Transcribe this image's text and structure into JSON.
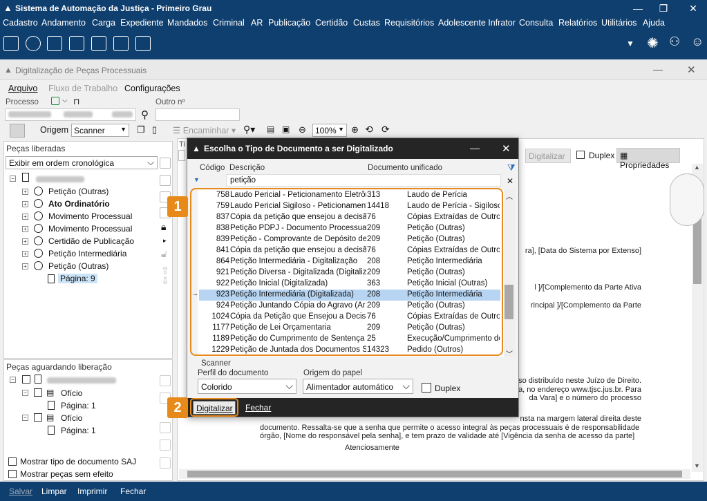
{
  "app": {
    "title": "Sistema de Automação da Justiça - Primeiro Grau",
    "menu": [
      "Cadastro",
      "Andamento",
      "Carga",
      "Expediente",
      "Mandados",
      "Criminal",
      "AR",
      "Publicação",
      "Certidão",
      "Custas",
      "Requisitórios",
      "Adolescente Infrator",
      "Consulta",
      "Relatórios",
      "Utilitários",
      "Ajuda"
    ]
  },
  "window": {
    "title": "Digitalização de Peças Processuais",
    "menu": {
      "arquivo": "Arquivo",
      "fluxo": "Fluxo de Trabalho",
      "config": "Configurações"
    },
    "processo_label": "Processo",
    "outro_label": "Outro nº",
    "origem_label": "Origem",
    "origem_value": "Scanner",
    "encaminhar": "Encaminhar",
    "zoom": "100%",
    "digitalizar_bg": "Digitalizar",
    "duplex_bg": "Duplex",
    "propriedades": "Propriedades"
  },
  "left": {
    "liberadas_title": "Peças liberadas",
    "sort": "Exibir em ordem cronológica",
    "tree": [
      {
        "label": "Petição (Outras)",
        "bold": false
      },
      {
        "label": "Ato Ordinatório",
        "bold": true
      },
      {
        "label": "Movimento Processual",
        "bold": false
      },
      {
        "label": "Movimento Processual",
        "bold": false
      },
      {
        "label": "Certidão de Publicação",
        "bold": false
      },
      {
        "label": "Petição Intermediária",
        "bold": false
      },
      {
        "label": "Petição (Outras)",
        "bold": false
      }
    ],
    "pagina_sel": "Página: 9",
    "aguardando_title": "Peças aguardando liberação",
    "aguardando": [
      {
        "label": "Ofício",
        "page": "Página: 1"
      },
      {
        "label": "Ofício",
        "page": "Página: 1"
      }
    ],
    "mostrar_tipo": "Mostrar tipo de documento SAJ",
    "mostrar_pecas": "Mostrar peças sem efeito"
  },
  "doc": {
    "lines": [
      "ra], [Data do Sistema por Extenso]",
      "l ]/[Complemento da Parte Ativa",
      "rincipal ]/[Complemento da Parte",
      "esso distribuído neste Juízo de Direito.",
      "a, no endereço www.tjsc.jus.br. Para",
      "da Vara] e o número do processo",
      "nsta na margem lateral direita deste",
      "documento. Ressalta-se que a senha que permite o acesso integral às peças processuais é de responsabilidade",
      "órgão, [Nome do responsável pela senha], e tem prazo de validade até [Vigência da senha de acesso da parte]",
      "Atenciosamente"
    ]
  },
  "bottom": [
    "Salvar",
    "Limpar",
    "Imprimir",
    "Fechar"
  ],
  "dialog": {
    "title": "Escolha o Tipo de Documento a ser Digitalizado",
    "col_codigo": "Código",
    "col_descricao": "Descrição",
    "col_unificado": "Documento unificado",
    "filter": "petição",
    "rows": [
      {
        "code": "758",
        "desc": "Laudo Pericial - Peticionamento Eletrôn",
        "ucode": "313",
        "udesc": "Laudo de Perícia"
      },
      {
        "code": "759",
        "desc": "Laudo Pericial Sigiloso - Peticionament",
        "ucode": "14418",
        "udesc": "Laudo de Perícia - Sigiloso"
      },
      {
        "code": "837",
        "desc": "Cópia da petição que ensejou a decisão",
        "ucode": "76",
        "udesc": "Cópias Extraídas de Outros"
      },
      {
        "code": "838",
        "desc": "Petição PDPJ - Documento Processual",
        "ucode": "209",
        "udesc": "Petição (Outras)"
      },
      {
        "code": "839",
        "desc": "Petição - Comprovante de Depósito de",
        "ucode": "209",
        "udesc": "Petição (Outras)"
      },
      {
        "code": "841",
        "desc": "Cópia da petição que ensejou a decisão",
        "ucode": "76",
        "udesc": "Cópias Extraídas de Outros"
      },
      {
        "code": "864",
        "desc": "Petição Intermediária - Digitalização",
        "ucode": "208",
        "udesc": "Petição Intermediária"
      },
      {
        "code": "921",
        "desc": "Petição Diversa - Digitalizada (Digitaliz",
        "ucode": "209",
        "udesc": "Petição (Outras)"
      },
      {
        "code": "922",
        "desc": "Petição Inicial (Digitalizada)",
        "ucode": "363",
        "udesc": "Petição Inicial (Outras)"
      },
      {
        "code": "923",
        "desc": "Petição Intermediária (Digitalizada)",
        "ucode": "208",
        "udesc": "Petição Intermediária"
      },
      {
        "code": "924",
        "desc": "Petição Juntando Cópia do Agravo (Ar",
        "ucode": "209",
        "udesc": "Petição (Outras)"
      },
      {
        "code": "1024",
        "desc": "Cópia da Petição que Ensejou a Decisão",
        "ucode": "76",
        "udesc": "Cópias Extraídas de Outros"
      },
      {
        "code": "1177",
        "desc": "Petição de Lei Orçamentaria",
        "ucode": "209",
        "udesc": "Petição (Outras)"
      },
      {
        "code": "1189",
        "desc": "Petição do Cumprimento de Sentença",
        "ucode": "25",
        "udesc": "Execução/Cumprimento de"
      },
      {
        "code": "1229",
        "desc": "Petição de Juntada dos Documentos Sc",
        "ucode": "14323",
        "udesc": "Pedido (Outros)"
      }
    ],
    "selected_index": 9,
    "scanner_label": "Scanner",
    "perfil_label": "Perfil do documento",
    "perfil_value": "Colorido",
    "origem_papel_label": "Origem do papel",
    "origem_papel_value": "Alimentador automático",
    "duplex": "Duplex",
    "btn_digitalizar": "Digitalizar",
    "btn_fechar": "Fechar",
    "badge1": "1",
    "badge2": "2"
  },
  "colors": {
    "navy": "#0f3f6e",
    "orange": "#e88a1a",
    "selection": "#b7d5f2"
  }
}
